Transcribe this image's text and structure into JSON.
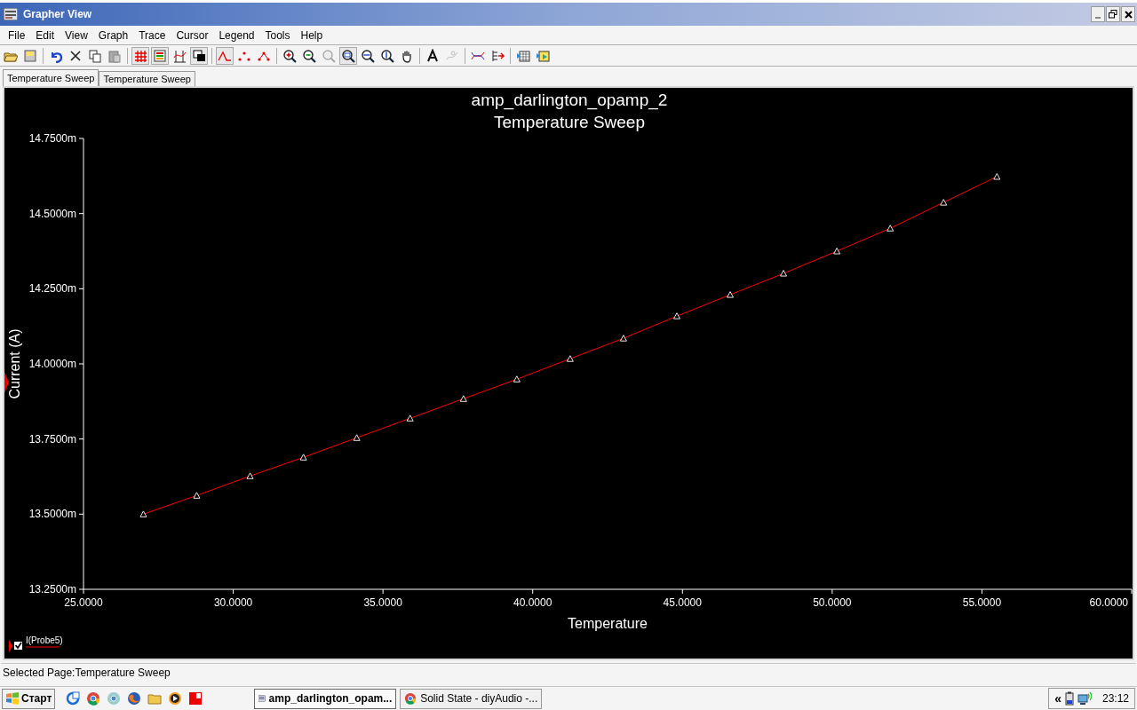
{
  "window": {
    "title": "Grapher View"
  },
  "menu": [
    "File",
    "Edit",
    "View",
    "Graph",
    "Trace",
    "Cursor",
    "Legend",
    "Tools",
    "Help"
  ],
  "tabs": [
    {
      "label": "Temperature Sweep",
      "selected": true
    },
    {
      "label": "Temperature Sweep",
      "selected": false
    }
  ],
  "graph": {
    "chart_data": {
      "type": "line",
      "title": "amp_darlington_opamp_2\nTemperature Sweep",
      "xlabel": "Temperature",
      "ylabel": "Current (A)",
      "x": [
        27.0,
        28.781,
        30.563,
        32.344,
        34.125,
        35.906,
        37.688,
        39.469,
        41.25,
        43.031,
        44.813,
        46.594,
        48.375,
        50.156,
        51.938,
        53.719,
        55.5
      ],
      "series": [
        {
          "name": "I(Probe5)",
          "color": "#ff0000",
          "marker": "triangle",
          "values": [
            13.5,
            13.562,
            13.627,
            13.689,
            13.754,
            13.819,
            13.884,
            13.949,
            14.017,
            14.085,
            14.159,
            14.23,
            14.301,
            14.375,
            14.451,
            14.537,
            14.623
          ]
        }
      ],
      "xlim": [
        25,
        60
      ],
      "ylim": [
        13.25,
        14.75
      ],
      "xticks": [
        {
          "value": 25,
          "label": "25.0000"
        },
        {
          "value": 30,
          "label": "30.0000"
        },
        {
          "value": 35,
          "label": "35.0000"
        },
        {
          "value": 40,
          "label": "40.0000"
        },
        {
          "value": 45,
          "label": "45.0000"
        },
        {
          "value": 50,
          "label": "50.0000"
        },
        {
          "value": 55,
          "label": "55.0000"
        },
        {
          "value": 60,
          "label": "60.0000"
        }
      ],
      "yticks": [
        {
          "value": 13.25,
          "label": "13.2500m"
        },
        {
          "value": 13.5,
          "label": "13.5000m"
        },
        {
          "value": 13.75,
          "label": "13.7500m"
        },
        {
          "value": 14.0,
          "label": "14.0000m"
        },
        {
          "value": 14.25,
          "label": "14.2500m"
        },
        {
          "value": 14.5,
          "label": "14.5000m"
        },
        {
          "value": 14.75,
          "label": "14.7500m"
        }
      ]
    },
    "legend": [
      {
        "checked": true
      }
    ]
  },
  "status_bar": "Selected Page:Temperature Sweep",
  "taskbar": {
    "start": "Старт",
    "tasks": [
      {
        "label": "amp_darlington_opam...",
        "selected": true
      },
      {
        "label": "Solid State - diyAudio -...",
        "selected": false
      }
    ],
    "tray_expand": "«",
    "clock": "23:12"
  }
}
